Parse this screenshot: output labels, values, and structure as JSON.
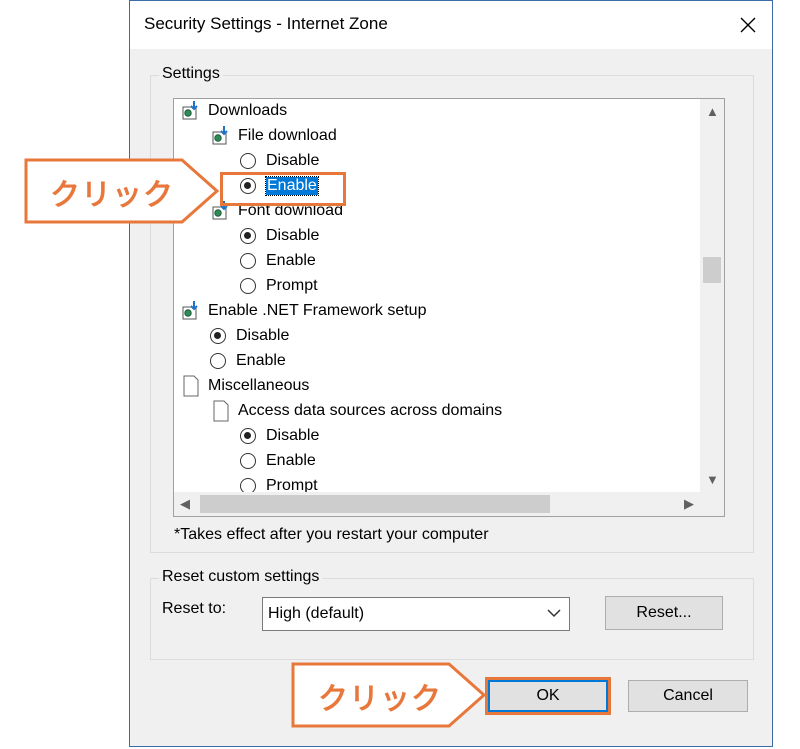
{
  "dialog": {
    "title": "Security Settings - Internet Zone",
    "close_icon": "close-icon"
  },
  "settings_group": {
    "label": "Settings",
    "tree": [
      {
        "kind": "folder",
        "icon": "settings-gear-icon",
        "label": "Downloads"
      },
      {
        "kind": "folder",
        "icon": "settings-gear-icon",
        "label": "File download"
      },
      {
        "kind": "radio",
        "label": "Disable",
        "checked": false
      },
      {
        "kind": "radio",
        "label": "Enable",
        "checked": true,
        "selected": true
      },
      {
        "kind": "folder",
        "icon": "settings-gear-icon",
        "label": "Font download"
      },
      {
        "kind": "radio",
        "label": "Disable",
        "checked": true
      },
      {
        "kind": "radio",
        "label": "Enable",
        "checked": false
      },
      {
        "kind": "radio",
        "label": "Prompt",
        "checked": false
      },
      {
        "kind": "folder",
        "icon": "settings-gear-icon",
        "label": "Enable .NET Framework setup"
      },
      {
        "kind": "radio",
        "label": "Disable",
        "checked": true
      },
      {
        "kind": "radio",
        "label": "Enable",
        "checked": false
      },
      {
        "kind": "doc",
        "icon": "document-icon",
        "label": "Miscellaneous"
      },
      {
        "kind": "doc",
        "icon": "document-icon",
        "label": "Access data sources across domains"
      },
      {
        "kind": "radio",
        "label": "Disable",
        "checked": true
      },
      {
        "kind": "radio",
        "label": "Enable",
        "checked": false
      },
      {
        "kind": "radio",
        "label": "Prompt",
        "checked": false
      }
    ],
    "note": "*Takes effect after you restart your computer"
  },
  "reset_group": {
    "label": "Reset custom settings",
    "reset_to_label": "Reset to:",
    "reset_to_value": "High (default)",
    "reset_button": "Reset..."
  },
  "buttons": {
    "ok": "OK",
    "cancel": "Cancel"
  },
  "callouts": {
    "enable_callout": "クリック",
    "ok_callout": "クリック",
    "accent_color": "#e8773b"
  }
}
